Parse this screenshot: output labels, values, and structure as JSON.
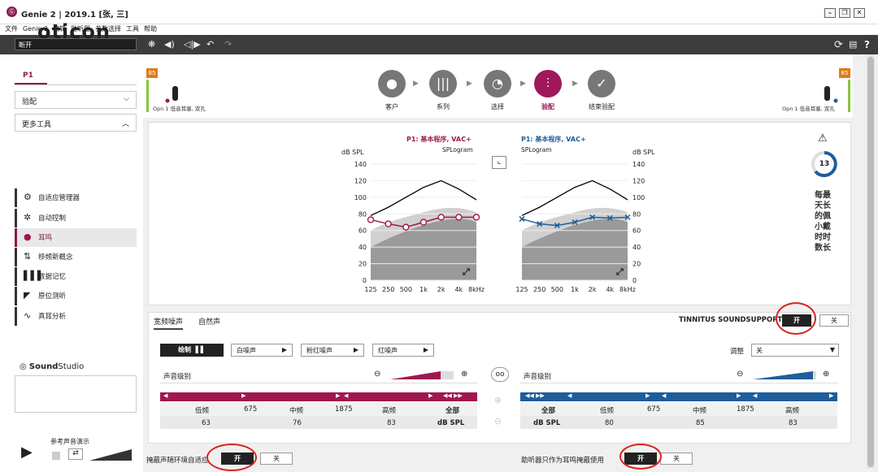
{
  "window": {
    "title": "Genie 2 | 2019.1 [张, 三]",
    "app_icon": "Ⓖ"
  },
  "menu": [
    "文件",
    "Genie 2",
    "编辑",
    "助听器",
    "参数选择",
    "工具",
    "帮助"
  ],
  "toolbar": {
    "connection": "断开"
  },
  "left": {
    "logo": "oticon",
    "program_tab": "P1",
    "dropdown": "验配",
    "more_tools": "更多工具",
    "tools": [
      "自适应管理器",
      "自动控制",
      "耳鸣",
      "移频新概念",
      "数据记忆",
      "原位测听",
      "真耳分析"
    ],
    "active_tool": 2,
    "soundstudio": {
      "brand": "Sound",
      "brand2": "Studio",
      "demo": "参考声音演示"
    }
  },
  "devices": {
    "left": {
      "badge": "85",
      "label": "Opn 1 低音耳塞, 双孔"
    },
    "right": {
      "badge": "85",
      "label": "Opn 1 低音耳塞, 双孔"
    }
  },
  "steps": [
    {
      "label": "客户",
      "active": false
    },
    {
      "label": "系列",
      "active": false
    },
    {
      "label": "选择",
      "active": false
    },
    {
      "label": "验配",
      "active": true
    },
    {
      "label": "结束验配",
      "active": false
    }
  ],
  "graphs": {
    "left": {
      "title": "P1: 基本程序, VAC+",
      "subtitle": "SPLogram",
      "unit": "dB SPL",
      "color": "#a0174f"
    },
    "right": {
      "title": "P1: 基本程序, VAC+",
      "subtitle": "SPLogram",
      "unit": "dB SPL",
      "color": "#1e5d9a"
    },
    "yticks": [
      "140",
      "120",
      "100",
      "80",
      "60",
      "40",
      "20",
      "0"
    ],
    "xticks": [
      "125",
      "250",
      "500",
      "1k",
      "2k",
      "4k",
      "8kHz"
    ]
  },
  "chart_data": [
    {
      "type": "line",
      "title": "P1: 基本程序, VAC+",
      "subtitle": "SPLogram",
      "ylabel": "dB SPL",
      "x": [
        "125",
        "250",
        "500",
        "1k",
        "2k",
        "4k",
        "8k"
      ],
      "ylim": [
        0,
        140
      ],
      "series": [
        {
          "values": [
            73,
            68,
            64,
            70,
            76,
            76,
            76
          ]
        },
        {
          "values": [
            78,
            88,
            100,
            112,
            120,
            110,
            97
          ]
        }
      ]
    },
    {
      "type": "line",
      "title": "P1: 基本程序, VAC+",
      "subtitle": "SPLogram",
      "ylabel": "dB SPL",
      "x": [
        "125",
        "250",
        "500",
        "1k",
        "2k",
        "4k",
        "8k"
      ],
      "ylim": [
        0,
        140
      ],
      "series": [
        {
          "values": [
            74,
            68,
            66,
            70,
            76,
            75,
            76
          ]
        },
        {
          "values": [
            78,
            88,
            100,
            112,
            120,
            110,
            97
          ]
        }
      ]
    }
  ],
  "tinnitus_side": {
    "count": "13",
    "text": [
      "每最",
      "天长",
      "的佩",
      "小戴",
      "时时",
      "数长"
    ]
  },
  "bottom": {
    "tabs": [
      "宽频噪声",
      "自然声"
    ],
    "soundsupport": "TINNITUS SOUNDSUPPORT",
    "on": "开",
    "off": "关",
    "draw": "绘制",
    "noises": [
      "白噪声",
      "粉红噪声",
      "红噪声"
    ],
    "adjust": "调整",
    "adjust_value": "关",
    "level": "声音级别",
    "left_cols": [
      "低频",
      "675",
      "中频",
      "1875",
      "高频",
      "全部"
    ],
    "left_vals": [
      "63",
      "76",
      "83",
      "dB SPL"
    ],
    "right_cols": [
      "全部",
      "低频",
      "675",
      "中频",
      "1875",
      "高频"
    ],
    "right_vals": [
      "dB SPL",
      "80",
      "85",
      "83"
    ],
    "mask_env": "掩蔽声随环境自适应",
    "hi_only": "助听器只作为耳鸣掩蔽使用"
  }
}
